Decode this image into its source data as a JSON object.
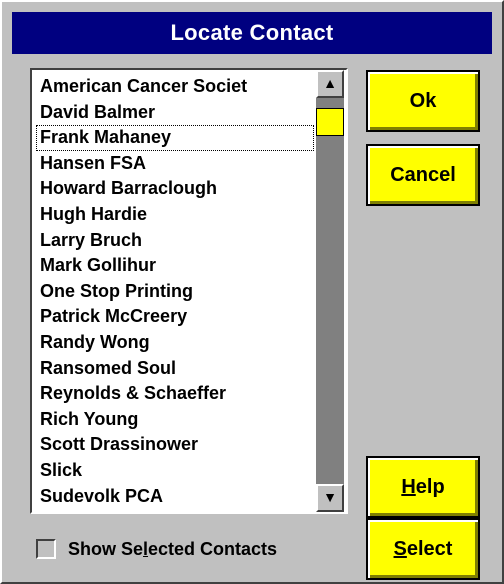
{
  "window": {
    "title": "Locate Contact"
  },
  "contacts": {
    "items": [
      "American Cancer Societ",
      "David Balmer",
      "Frank Mahaney",
      "Hansen FSA",
      "Howard Barraclough",
      "Hugh Hardie",
      "Larry Bruch",
      "Mark Gollihur",
      "One Stop Printing",
      "Patrick McCreery",
      "Randy Wong",
      "Ransomed Soul",
      "Reynolds & Schaeffer",
      "Rich Young",
      "Scott Drassinower",
      "Slick",
      "Sudevolk PCA"
    ],
    "focused_item": "Frank Mahaney",
    "scroll_up_icon": "arrow-up",
    "scroll_down_icon": "arrow-down"
  },
  "buttons": {
    "ok": "Ok",
    "cancel": "Cancel",
    "help_pre": "",
    "help_mnemonic": "H",
    "help_post": "elp",
    "select_pre": "",
    "select_mnemonic": "S",
    "select_post": "elect"
  },
  "options": {
    "show_selected_pre": "Show Se",
    "show_selected_mnemonic": "l",
    "show_selected_post": "ected Contacts",
    "show_selected_checked": false
  },
  "colors": {
    "title_bg": "#000080",
    "button_bg": "#ffff00",
    "dialog_bg": "#c0c0c0",
    "scroll_track": "#808080"
  }
}
